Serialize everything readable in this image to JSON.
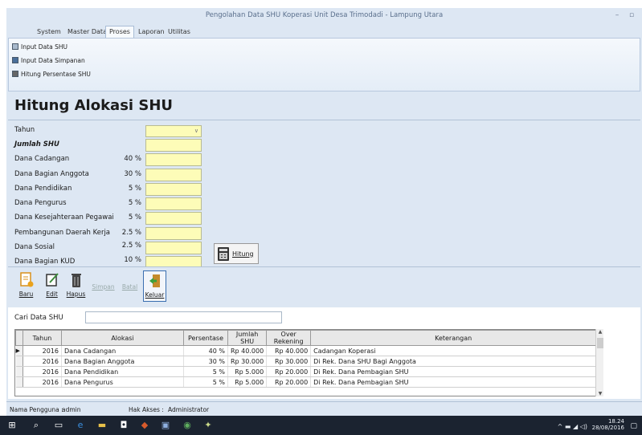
{
  "window": {
    "title": "Pengolahan Data SHU Koperasi Unit Desa Trimodadi - Lampung Utara",
    "min_glyph": "–",
    "max_glyph": "▫"
  },
  "menu": {
    "tabs": [
      "System",
      "Master Data",
      "Proses",
      "Laporan",
      "Utilitas"
    ],
    "active": "Proses"
  },
  "ribbon": {
    "items": [
      "Input Data SHU",
      "Input Data Simpanan",
      "Hitung Persentase SHU"
    ]
  },
  "form": {
    "heading": "Hitung Alokasi SHU",
    "fields": [
      {
        "label": "Tahun",
        "pct": "",
        "type": "select"
      },
      {
        "label": "Jumlah SHU",
        "pct": "",
        "type": "input",
        "bold": true
      },
      {
        "label": "Dana Cadangan",
        "pct": "40 %",
        "type": "input"
      },
      {
        "label": "Dana Bagian Anggota",
        "pct": "30 %",
        "type": "input"
      },
      {
        "label": "Dana Pendidikan",
        "pct": "5 %",
        "type": "input"
      },
      {
        "label": "Dana Pengurus",
        "pct": "5 %",
        "type": "input"
      },
      {
        "label": "Dana Kesejahteraan Pegawai",
        "pct": "5 %",
        "type": "input"
      },
      {
        "label": "Pembangunan Daerah Kerja",
        "pct": "2.5 %",
        "type": "input"
      },
      {
        "label": "Dana Sosial",
        "pct": "2.5 %",
        "type": "input"
      },
      {
        "label": "Dana Bagian KUD",
        "pct": "10 %",
        "type": "input"
      }
    ],
    "hitung_label": "Hitung"
  },
  "toolbar": {
    "baru": "Baru",
    "edit": "Edit",
    "hapus": "Hapus",
    "simpan": "Simpan",
    "batal": "Batal",
    "keluar": "Keluar"
  },
  "search": {
    "label": "Cari Data SHU",
    "value": ""
  },
  "grid": {
    "columns": [
      "Tahun",
      "Alokasi",
      "Persentase",
      "Jumlah SHU",
      "Over Rekening",
      "Keterangan"
    ],
    "rows": [
      [
        "2016",
        "Dana Cadangan",
        "40 %",
        "Rp 40.000",
        "Rp 40.000",
        "Cadangan Koperasi"
      ],
      [
        "2016",
        "Dana Bagian Anggota",
        "30 %",
        "Rp 30.000",
        "Rp 30.000",
        "Di Rek. Dana SHU Bagi Anggota"
      ],
      [
        "2016",
        "Dana Pendidikan",
        "5 %",
        "Rp 5.000",
        "Rp 20.000",
        "Di Rek. Dana Pembagian SHU"
      ],
      [
        "2016",
        "Dana Pengurus",
        "5 %",
        "Rp 5.000",
        "Rp 20.000",
        "Di Rek. Dana Pembagian SHU"
      ]
    ]
  },
  "status": {
    "user_label": "Nama Pengguna :",
    "user": "admin",
    "access_label": "Hak Akses :",
    "access": "Administrator"
  },
  "taskbar": {
    "time": "18.24",
    "date": "28/08/2016"
  }
}
